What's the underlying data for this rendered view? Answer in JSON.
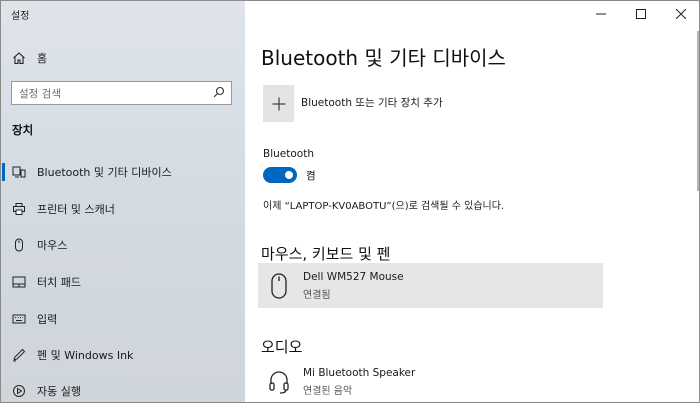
{
  "window": {
    "title": "설정"
  },
  "sidebar": {
    "home_label": "홈",
    "search_placeholder": "설정 검색",
    "section_title": "장치",
    "items": [
      {
        "label": "Bluetooth 및 기타 디바이스",
        "icon": "bluetooth-devices-icon",
        "active": true
      },
      {
        "label": "프린터 및 스캐너",
        "icon": "printer-icon"
      },
      {
        "label": "마우스",
        "icon": "mouse-icon"
      },
      {
        "label": "터치 패드",
        "icon": "touchpad-icon"
      },
      {
        "label": "입력",
        "icon": "keyboard-icon"
      },
      {
        "label": "펜 및 Windows Ink",
        "icon": "pen-icon"
      },
      {
        "label": "자동 실행",
        "icon": "autoplay-icon"
      }
    ]
  },
  "main": {
    "title": "Bluetooth 및 기타 디바이스",
    "add_device_label": "Bluetooth 또는 기타 장치 추가",
    "bluetooth": {
      "heading": "Bluetooth",
      "toggle_state": "켬",
      "discoverable_text": "이제 “LAPTOP-KV0ABOTU”(으)로 검색될 수 있습니다."
    },
    "groups": [
      {
        "title": "마우스, 키보드 및 펜",
        "devices": [
          {
            "name": "Dell WM527 Mouse",
            "status": "연결됨",
            "icon": "mouse-icon"
          }
        ]
      },
      {
        "title": "오디오",
        "devices": [
          {
            "name": "Mi Bluetooth Speaker",
            "status": "연결된 음악",
            "icon": "headset-icon"
          }
        ]
      }
    ]
  },
  "colors": {
    "accent": "#0067c0",
    "sidebar_bg": "#d7dee5",
    "selected_row": "#e6e6e6"
  }
}
